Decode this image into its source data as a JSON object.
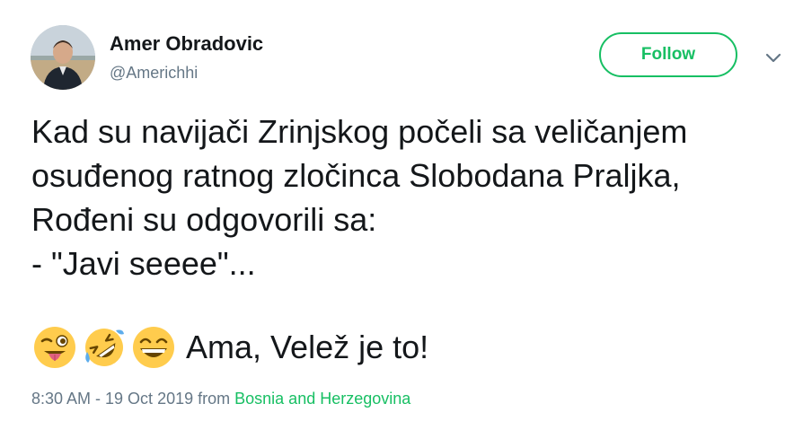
{
  "user": {
    "name": "Amer Obradovic",
    "handle": "@Americhhi"
  },
  "follow_label": "Follow",
  "tweet": {
    "lines": [
      "Kad su navijači Zrinjskog počeli sa veličanjem",
      "osuđenog ratnog zločinca Slobodana Praljka,",
      "Rođeni su odgovorili sa:",
      "- \"Javi seeee\"..."
    ],
    "closing_text": "Ama, Velež je to!",
    "emojis": [
      "winking-face-with-tongue",
      "rolling-on-the-floor-laughing",
      "grinning-squinting-face"
    ]
  },
  "meta": {
    "time_date": "8:30 AM - 19 Oct 2019",
    "from_label": "from",
    "location": "Bosnia and Herzegovina"
  },
  "colors": {
    "accent": "#17bf63",
    "text": "#14171a",
    "muted": "#657786"
  }
}
